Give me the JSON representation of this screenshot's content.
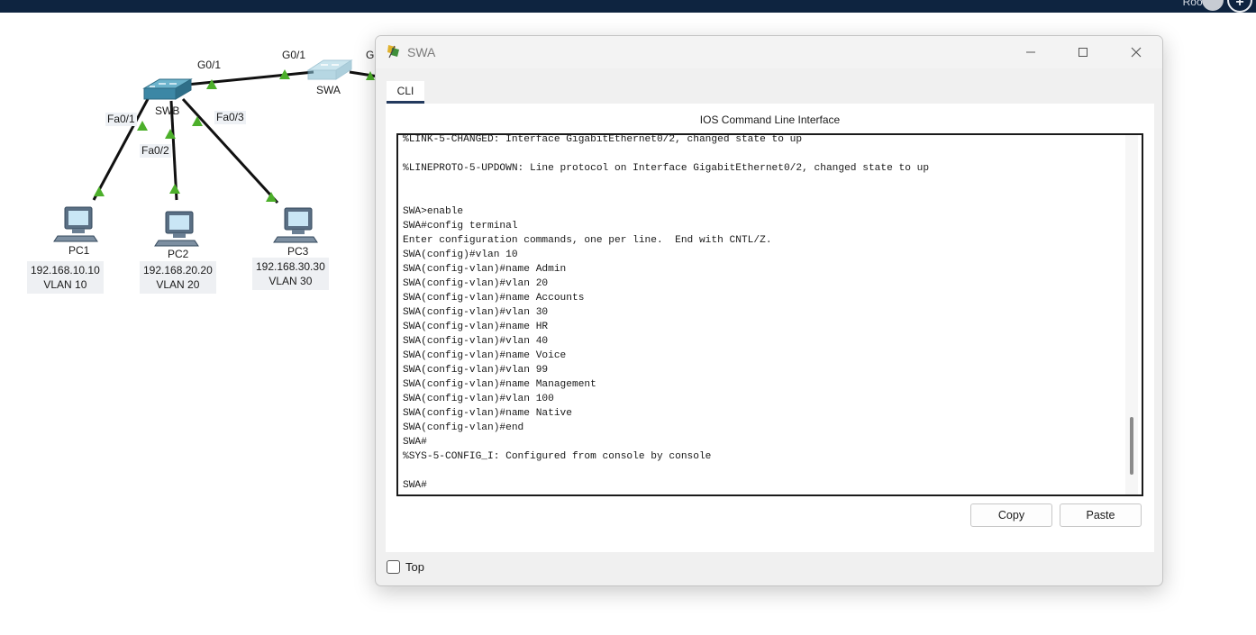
{
  "topbar": {
    "user_label": "Root"
  },
  "topology": {
    "devices": {
      "swb": "SWB",
      "swa": "SWA",
      "pc1": "PC1",
      "pc2": "PC2",
      "pc3": "PC3"
    },
    "ports": {
      "swb_g01": "G0/1",
      "swa_g01": "G0/1",
      "swa_g0x": "G",
      "fa01": "Fa0/1",
      "fa02": "Fa0/2",
      "fa03": "Fa0/3"
    },
    "pcs": [
      {
        "ip": "192.168.10.10",
        "vlan": "VLAN 10"
      },
      {
        "ip": "192.168.20.20",
        "vlan": "VLAN 20"
      },
      {
        "ip": "192.168.30.30",
        "vlan": "VLAN 30"
      }
    ],
    "colors": {
      "link": "#111111",
      "port_up": "#4caf2a"
    }
  },
  "window": {
    "title": "SWA",
    "tab": "CLI",
    "panel_title": "IOS Command Line Interface",
    "terminal_lines": [
      "%LINK-5-CHANGED: Interface GigabitEthernet0/2, changed state to up",
      "",
      "%LINEPROTO-5-UPDOWN: Line protocol on Interface GigabitEthernet0/2, changed state to up",
      "",
      "",
      "SWA>enable",
      "SWA#config terminal",
      "Enter configuration commands, one per line.  End with CNTL/Z.",
      "SWA(config)#vlan 10",
      "SWA(config-vlan)#name Admin",
      "SWA(config-vlan)#vlan 20",
      "SWA(config-vlan)#name Accounts",
      "SWA(config-vlan)#vlan 30",
      "SWA(config-vlan)#name HR",
      "SWA(config-vlan)#vlan 40",
      "SWA(config-vlan)#name Voice",
      "SWA(config-vlan)#vlan 99",
      "SWA(config-vlan)#name Management",
      "SWA(config-vlan)#vlan 100",
      "SWA(config-vlan)#name Native",
      "SWA(config-vlan)#end",
      "SWA#",
      "%SYS-5-CONFIG_I: Configured from console by console",
      "",
      "SWA#"
    ],
    "copy_label": "Copy",
    "paste_label": "Paste",
    "top_label": "Top",
    "top_checked": false,
    "colors": {
      "tab_underline": "#233a5e"
    }
  }
}
